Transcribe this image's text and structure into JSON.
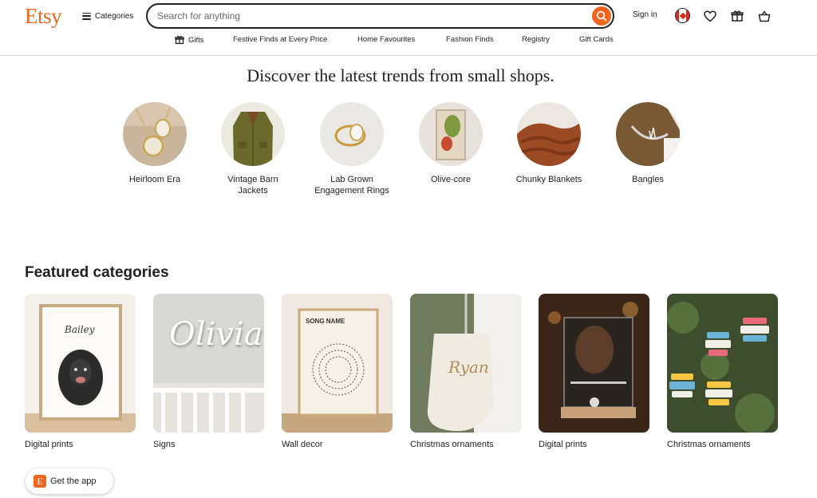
{
  "header": {
    "logo": "Etsy",
    "categories_label": "Categories",
    "search_placeholder": "Search for anything",
    "signin_label": "Sign in",
    "accent_color": "#f1641e"
  },
  "nav": {
    "items": [
      {
        "label": "Gifts",
        "icon": "gift-icon"
      },
      {
        "label": "Festive Finds at Every Price"
      },
      {
        "label": "Home Favourites"
      },
      {
        "label": "Fashion Finds"
      },
      {
        "label": "Registry"
      },
      {
        "label": "Gift Cards"
      }
    ]
  },
  "trends": {
    "title": "Discover the latest trends from small shops.",
    "items": [
      {
        "label": "Heirloom Era"
      },
      {
        "label": "Vintage Barn Jackets"
      },
      {
        "label": "Lab Grown Engagement Rings"
      },
      {
        "label": "Olive-core"
      },
      {
        "label": "Chunky Blankets"
      },
      {
        "label": "Bangles"
      }
    ]
  },
  "featured": {
    "title": "Featured categories",
    "items": [
      {
        "label": "Digital prints",
        "image_text": "Bailey"
      },
      {
        "label": "Signs",
        "image_text": "Olivia"
      },
      {
        "label": "Wall decor",
        "image_text": "SONG NAME"
      },
      {
        "label": "Christmas ornaments",
        "image_text": "Ryan"
      },
      {
        "label": "Digital prints"
      },
      {
        "label": "Christmas ornaments"
      }
    ]
  },
  "app_button": {
    "label": "Get the app",
    "logo_letter": "E"
  }
}
